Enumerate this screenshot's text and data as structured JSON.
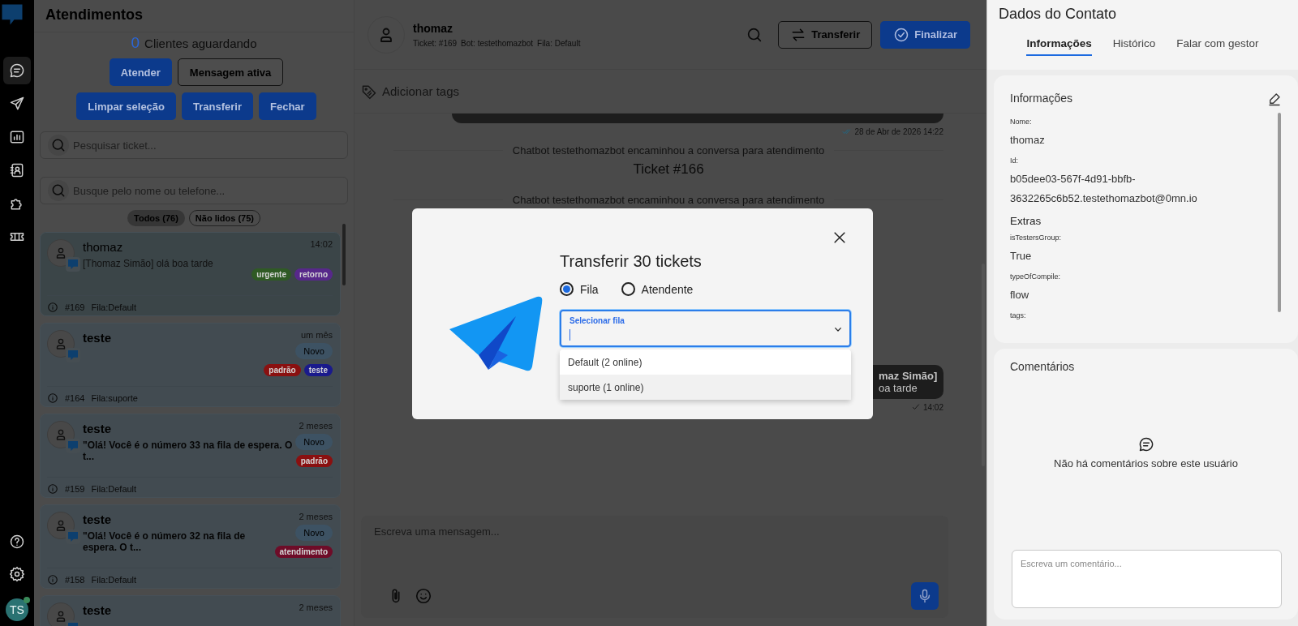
{
  "nav": {
    "items": [
      {
        "selected": true
      },
      {
        "selected": false
      },
      {
        "selected": false
      },
      {
        "selected": false
      },
      {
        "selected": false
      },
      {
        "selected": false
      }
    ],
    "avatar": {
      "initials": "TS",
      "online": true
    }
  },
  "tickets_panel": {
    "title": "Atendimentos",
    "waiting_count": "0",
    "waiting_label": "Clientes aguardando",
    "buttons": [
      {
        "label": "Atender",
        "kind": "primary"
      },
      {
        "label": "Mensagem ativa",
        "kind": "outline"
      },
      {
        "label": "Limpar seleção",
        "kind": "primary"
      },
      {
        "label": "Transferir",
        "kind": "primary"
      },
      {
        "label": "Fechar",
        "kind": "primary"
      }
    ],
    "search_fields": [
      {
        "placeholder": "Pesquisar ticket..."
      },
      {
        "placeholder": "Busque pelo nome ou telefone..."
      }
    ],
    "filters": [
      {
        "label": "Todos (76)",
        "selected": true
      },
      {
        "label": "Não lidos (75)",
        "selected": false
      }
    ],
    "tickets": [
      {
        "name": "thomaz",
        "time": "14:02",
        "preview": "[Thomaz Simão] olá boa tarde",
        "tags": [
          {
            "label": "urgente",
            "color": "#2f5a24"
          },
          {
            "label": "retorno",
            "color": "#57288a"
          }
        ],
        "number": "#169",
        "queue": "Fila:Default",
        "selected": true
      },
      {
        "name": "teste",
        "time": "um mês",
        "badge": "Novo",
        "tags": [
          {
            "label": "padrão",
            "color": "#8a1010"
          },
          {
            "label": "teste",
            "color": "#1a1a8c"
          }
        ],
        "number": "#164",
        "queue": "Fila:suporte",
        "selected": false
      },
      {
        "name": "teste",
        "time": "2 meses",
        "preview": "\"Olá! Você é o número 33 na fila de espera. O t...",
        "badge": "Novo",
        "tags": [
          {
            "label": "padrão",
            "color": "#8a1010"
          }
        ],
        "number": "#159",
        "queue": "Fila:Default",
        "selected": false
      },
      {
        "name": "teste",
        "time": "2 meses",
        "preview": "\"Olá! Você é o número 32 na fila de espera. O t...",
        "badge": "Novo",
        "tags": [
          {
            "label": "atendimento",
            "color": "#6e0c28"
          }
        ],
        "number": "#158",
        "queue": "Fila:Default",
        "selected": false
      },
      {
        "name": "teste",
        "time": "2 meses",
        "selected": false
      }
    ]
  },
  "chat": {
    "contact": {
      "name": "thomaz",
      "ticket": "Ticket: #169",
      "bot": "Bot: testethomazbot",
      "queue": "Fila: Default"
    },
    "buttons": [
      {
        "label": "Transferir",
        "kind": "outline"
      },
      {
        "label": "Finalizar",
        "kind": "primary"
      }
    ],
    "add_tags": "Adicionar tags",
    "messages": [
      {
        "kind": "outgoing",
        "time": "28 de Abr de 2026 14:22",
        "read": true
      },
      {
        "kind": "system",
        "text": "Chatbot testethomazbot encaminhou a conversa para atendimento"
      },
      {
        "kind": "ticket",
        "text": "Ticket #166"
      },
      {
        "kind": "system",
        "text": "Chatbot testethomazbot encaminhou a conversa para atendimento"
      },
      {
        "kind": "outgoing",
        "lines": [
          "maz Simão]",
          "oa tarde"
        ],
        "time": "14:02",
        "read": false
      }
    ],
    "composer": {
      "placeholder": "Escreva uma mensagem..."
    }
  },
  "contact_panel": {
    "title": "Dados do Contato",
    "tabs": [
      {
        "label": "Informações",
        "selected": true
      },
      {
        "label": "Histórico",
        "selected": false
      },
      {
        "label": "Falar com gestor",
        "selected": false
      }
    ],
    "info": {
      "title": "Informações",
      "fields": [
        {
          "label": "Nome:",
          "value": "thomaz"
        },
        {
          "label": "Id:",
          "value": "b05dee03-567f-4d91-bbfb-3632265c6b52.testethomazbot@0mn.io"
        }
      ],
      "extras_title": "Extras",
      "extras": [
        {
          "label": "isTestersGroup:",
          "value": "True"
        },
        {
          "label": "typeOfCompile:",
          "value": "flow"
        },
        {
          "label": "tags:"
        }
      ]
    },
    "comments": {
      "title": "Comentários",
      "empty": "Não há comentários sobre este usuário",
      "placeholder": "Escreva um comentário..."
    }
  },
  "modal": {
    "title": "Transferir 30 tickets",
    "options": [
      {
        "label": "Fila",
        "selected": true
      },
      {
        "label": "Atendente",
        "selected": false
      }
    ],
    "select": {
      "label": "Selecionar fila",
      "focused": true
    },
    "dropdown": [
      {
        "label": "Default (2 online)",
        "highlighted": false
      },
      {
        "label": "suporte (1 online)",
        "highlighted": true
      }
    ]
  }
}
